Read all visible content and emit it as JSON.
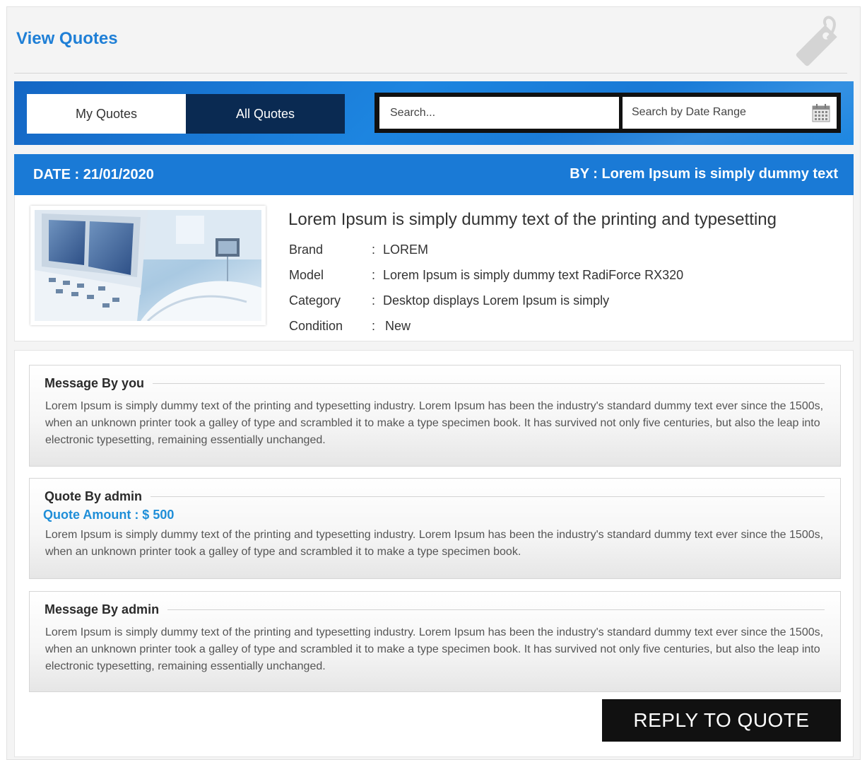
{
  "page": {
    "title": "View Quotes"
  },
  "tabs": {
    "my_quotes": "My Quotes",
    "all_quotes": "All Quotes"
  },
  "search": {
    "placeholder": "Search...",
    "date_range_label": "Search by Date Range"
  },
  "quote_header": {
    "date": "DATE :  21/01/2020",
    "by": "BY : Lorem Ipsum is simply dummy text"
  },
  "product": {
    "title": "Lorem Ipsum is simply dummy text of the printing and typesetting",
    "specs": [
      {
        "key": "Brand",
        "value": "LOREM"
      },
      {
        "key": "Model",
        "value": "Lorem Ipsum is simply dummy text RadiForce RX320"
      },
      {
        "key": "Category",
        "value": "Desktop displays Lorem Ipsum is simply"
      },
      {
        "key": "Condition",
        "value": "New"
      }
    ]
  },
  "messages": [
    {
      "heading": "Message By you",
      "body": "Lorem Ipsum is simply dummy text of the printing and typesetting industry. Lorem Ipsum has been the industry's standard dummy text ever since the 1500s, when an unknown printer took a galley of type and scrambled it to make a type specimen book. It has survived not only five centuries, but also the leap into electronic typesetting, remaining essentially unchanged."
    },
    {
      "heading": "Quote By admin",
      "amount": "Quote Amount : $ 500",
      "body": "Lorem Ipsum is simply dummy text of the printing and typesetting industry. Lorem Ipsum has been the industry's standard dummy text ever since the 1500s, when an unknown printer took a galley of type and scrambled it to make a type specimen book."
    },
    {
      "heading": "Message By admin",
      "body": "Lorem Ipsum is simply dummy text of the printing and typesetting industry. Lorem Ipsum has been the industry's standard dummy text ever since the 1500s, when an unknown printer took a galley of type and scrambled it to make a type specimen book. It has survived not only five centuries, but also the leap into electronic typesetting, remaining essentially unchanged."
    }
  ],
  "actions": {
    "reply_label": "REPLY TO QUOTE"
  },
  "icons": {
    "title_icon": "price-tag-icon",
    "date_icon": "calendar-icon"
  },
  "colors": {
    "accent": "#1a7ad6",
    "title": "#1f7fd6",
    "dark_tab": "#0a2a52",
    "amount": "#1f8ed8"
  }
}
